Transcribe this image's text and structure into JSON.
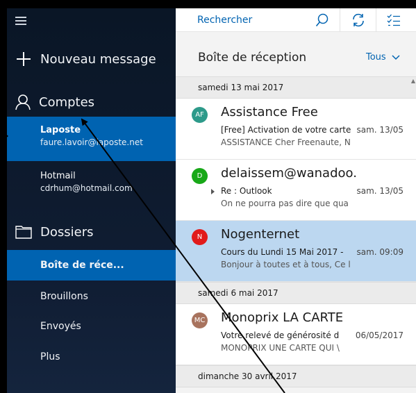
{
  "colors": {
    "accent": "#0063b1",
    "selected_message": "#bcd7f0",
    "sidebar_bg": "#0d1a2d"
  },
  "sidebar": {
    "menu_icon": "hamburger-icon",
    "new_message": "Nouveau message",
    "accounts_label": "Comptes",
    "accounts": [
      {
        "name": "Laposte",
        "email": "faure.lavoir@laposte.net",
        "selected": true
      },
      {
        "name": "Hotmail",
        "email": "cdrhum@hotmail.com",
        "selected": false
      }
    ],
    "folders_label": "Dossiers",
    "folders": [
      {
        "label": "Boîte de réce...",
        "selected": true
      },
      {
        "label": "Brouillons",
        "selected": false
      },
      {
        "label": "Envoyés",
        "selected": false
      },
      {
        "label": "Plus",
        "selected": false
      }
    ]
  },
  "toolbar": {
    "search_placeholder": "Rechercher",
    "icons": [
      "search-icon",
      "sync-icon",
      "select-mode-icon"
    ]
  },
  "inbox": {
    "title": "Boîte de réception",
    "filter": "Tous",
    "groups": [
      {
        "date": "samedi 13 mai 2017",
        "messages": [
          {
            "initials": "AF",
            "avatar_color": "#2d9a8a",
            "sender": "Assistance Free",
            "subject": "[Free] Activation de votre carte",
            "preview": "ASSISTANCE Cher Freenaute, N",
            "date": "sam. 13/05"
          },
          {
            "initials": "D",
            "avatar_color": "#18a818",
            "sender": "delaissem@wanadoo.",
            "subject": "Re : Outlook",
            "preview": "On ne pourra pas dire que qua",
            "date": "sam. 13/05"
          },
          {
            "initials": "N",
            "avatar_color": "#e11a1a",
            "sender": "Nogenternet",
            "subject": "Cours du Lundi 15 Mai 2017 -",
            "preview": "Bonjour à toutes et à tous, Ce l",
            "date": "sam. 09:09"
          }
        ]
      },
      {
        "date": "samedi 6 mai 2017",
        "messages": [
          {
            "initials": "MC",
            "avatar_color": "#a8735e",
            "sender": "Monoprix LA CARTE",
            "subject": "Votre relevé de générosité d",
            "preview": "MONOPRIX UNE CARTE QUI \\",
            "date": "06/05/2017"
          }
        ]
      },
      {
        "date": "dimanche 30 avril 2017",
        "messages": []
      }
    ]
  }
}
